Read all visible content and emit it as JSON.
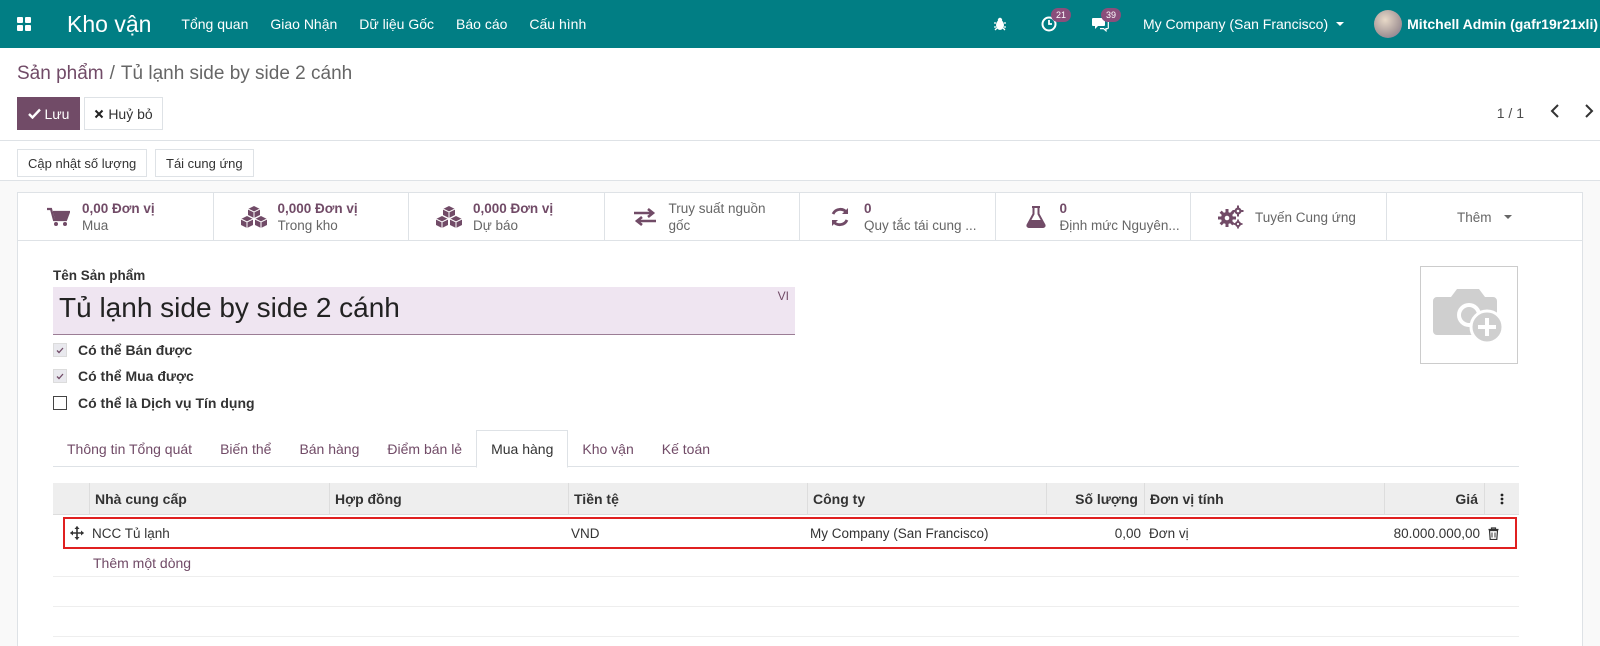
{
  "navbar": {
    "app_name": "Kho vận",
    "menu": [
      "Tổng quan",
      "Giao Nhận",
      "Dữ liệu Gốc",
      "Báo cáo",
      "Cấu hình"
    ],
    "activity_count": "21",
    "message_count": "39",
    "company": "My Company (San Francisco)",
    "user": "Mitchell Admin (gafr19r21xli)"
  },
  "breadcrumb": {
    "parent": "Sản phẩm",
    "separator": "/",
    "current": "Tủ lạnh side by side 2 cánh"
  },
  "actions": {
    "save": "Lưu",
    "cancel": "Huỷ bỏ",
    "pager": "1 / 1"
  },
  "header_buttons": [
    "Cập nhật số lượng",
    "Tái cung ứng"
  ],
  "smart_buttons": [
    {
      "value": "0,00 Đơn vị",
      "label": "Mua",
      "icon": "cart-icon"
    },
    {
      "value": "0,000 Đơn vị",
      "label": "Trong kho",
      "icon": "cubes-icon"
    },
    {
      "value": "0,000 Đơn vị",
      "label": "Dự báo",
      "icon": "cubes-icon"
    },
    {
      "value": "",
      "label": "Truy suất nguồn gốc",
      "label_line1": "Truy suất nguồn",
      "label_line2": "gốc",
      "icon": "exchange-icon"
    },
    {
      "value": "0",
      "label": "Quy tắc tái cung ...",
      "icon": "refresh-icon"
    },
    {
      "value": "0",
      "label": "Định mức Nguyên...",
      "icon": "flask-icon"
    },
    {
      "value": "",
      "label": "Tuyến Cung ứng",
      "icon": "cogs-icon"
    },
    {
      "value": "",
      "label": "Thêm",
      "icon": "chevron-down-icon"
    }
  ],
  "form": {
    "name_label": "Tên Sản phẩm",
    "name_value": "Tủ lạnh side by side 2 cánh",
    "lang": "VI",
    "checkboxes": [
      {
        "label": "Có thể Bán được",
        "checked": true
      },
      {
        "label": "Có thể Mua được",
        "checked": true
      },
      {
        "label": "Có thể là Dịch vụ Tín dụng",
        "checked": false
      }
    ]
  },
  "tabs": [
    "Thông tin Tổng quát",
    "Biến thể",
    "Bán hàng",
    "Điểm bán lẻ",
    "Mua hàng",
    "Kho vận",
    "Kế toán"
  ],
  "active_tab": "Mua hàng",
  "table": {
    "headers": [
      "Nhà cung cấp",
      "Hợp đồng",
      "Tiền tệ",
      "Công ty",
      "Số lượng",
      "Đơn vị tính",
      "Giá"
    ],
    "rows": [
      {
        "vendor": "NCC Tủ lạnh",
        "contract": "",
        "currency": "VND",
        "company": "My Company (San Francisco)",
        "qty": "0,00",
        "uom": "Đơn vị",
        "price": "80.000.000,00"
      }
    ],
    "add_line": "Thêm một dòng"
  },
  "colors": {
    "navbar": "#017e84",
    "primary": "#714b67",
    "highlight": "#e02020"
  }
}
